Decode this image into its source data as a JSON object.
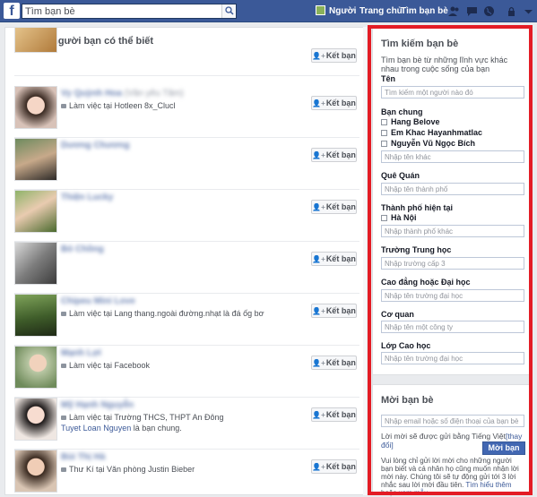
{
  "topbar": {
    "logo": "f",
    "search_placeholder": "Tìm bạn bè",
    "nav": [
      "Người",
      "Trang chủ",
      "Tìm bạn bè"
    ]
  },
  "left": {
    "title": "Những người bạn có thể biết",
    "add_label": "Kết bạn",
    "friends": [
      {
        "name": "",
        "name_extra": "",
        "work": "",
        "mutual_name": "",
        "mutual_text": ""
      },
      {
        "name": "Vy Quỳnh Hoa",
        "name_extra": "(Vân yêu Tâm)",
        "work": "Làm việc tại Hotleen 8x_Clucl",
        "mutual_name": "",
        "mutual_text": ""
      },
      {
        "name": "Dương Chương",
        "name_extra": "",
        "work": "",
        "mutual_name": "",
        "mutual_text": ""
      },
      {
        "name": "Thiện Lucky",
        "name_extra": "",
        "work": "",
        "mutual_name": "",
        "mutual_text": ""
      },
      {
        "name": "Bó Chồng",
        "name_extra": "",
        "work": "",
        "mutual_name": "",
        "mutual_text": ""
      },
      {
        "name": "Chipeu Mini Love",
        "name_extra": "",
        "work": "Làm việc tại Lang thang.ngoài đường.nhạt là đá ốg bơ",
        "mutual_name": "",
        "mutual_text": ""
      },
      {
        "name": "Mạnh Lợi",
        "name_extra": "",
        "work": "Làm việc tại Facebook",
        "mutual_name": "",
        "mutual_text": ""
      },
      {
        "name": "Mỹ Hạnh Nguyễn",
        "name_extra": "",
        "work": "Làm việc tại Trường THCS, THPT An Đông",
        "mutual_name": "Tuyet Loan Nguyen",
        "mutual_text": " là bạn chung."
      },
      {
        "name": "Bùi Thị Hà",
        "name_extra": "",
        "work": "Thư Kí tại Văn phòng Justin Bieber",
        "mutual_name": "",
        "mutual_text": ""
      }
    ]
  },
  "right": {
    "search_title": "Tìm kiếm bạn bè",
    "search_desc": "Tìm bạn bè từ những lĩnh vực khác nhau trong cuộc sống của bạn",
    "name_label": "Tên",
    "name_placeholder": "Tìm kiếm một người nào đó",
    "mutual_label": "Bạn chung",
    "mutual_options": [
      "Hang Belove",
      "Em Khac Hayanhmatlac",
      "Nguyễn Vũ Ngọc Bích"
    ],
    "mutual_placeholder": "Nhập tên khác",
    "hometown_label": "Quê Quán",
    "hometown_placeholder": "Nhập tên thành phố",
    "city_label": "Thành phố hiện tại",
    "city_options": [
      "Hà Nội"
    ],
    "city_placeholder": "Nhập thành phố khác",
    "highschool_label": "Trường Trung học",
    "highschool_placeholder": "Nhập trường cấp 3",
    "college_label": "Cao đẳng hoặc Đại học",
    "college_placeholder": "Nhập tên trường đại học",
    "employer_label": "Cơ quan",
    "employer_placeholder": "Nhập tên một công ty",
    "grad_label": "Lớp Cao học",
    "grad_placeholder": "Nhập tên trường đại học",
    "invite_title": "Mời bạn bè",
    "invite_placeholder": "Nhập email hoặc số điện thoại của bạn bè",
    "invite_lang": "Lời mời sẽ được gửi bằng Tiếng Việt",
    "invite_lang_change": "[thay đổi]",
    "invite_button": "Mời bạn bè",
    "invite_note": "Vui lòng chỉ gửi lời mời cho những người bạn biết và cá nhân họ cũng muốn nhận lời mời này. Chúng tôi sẽ tự động gửi tới 3 lời nhắc sau lời mời đầu tiên.",
    "invite_learn_more": "Tìm hiểu thêm",
    "invite_or": " hoặc ",
    "invite_see_more": "xem mẫu",
    "invite_end": "."
  }
}
